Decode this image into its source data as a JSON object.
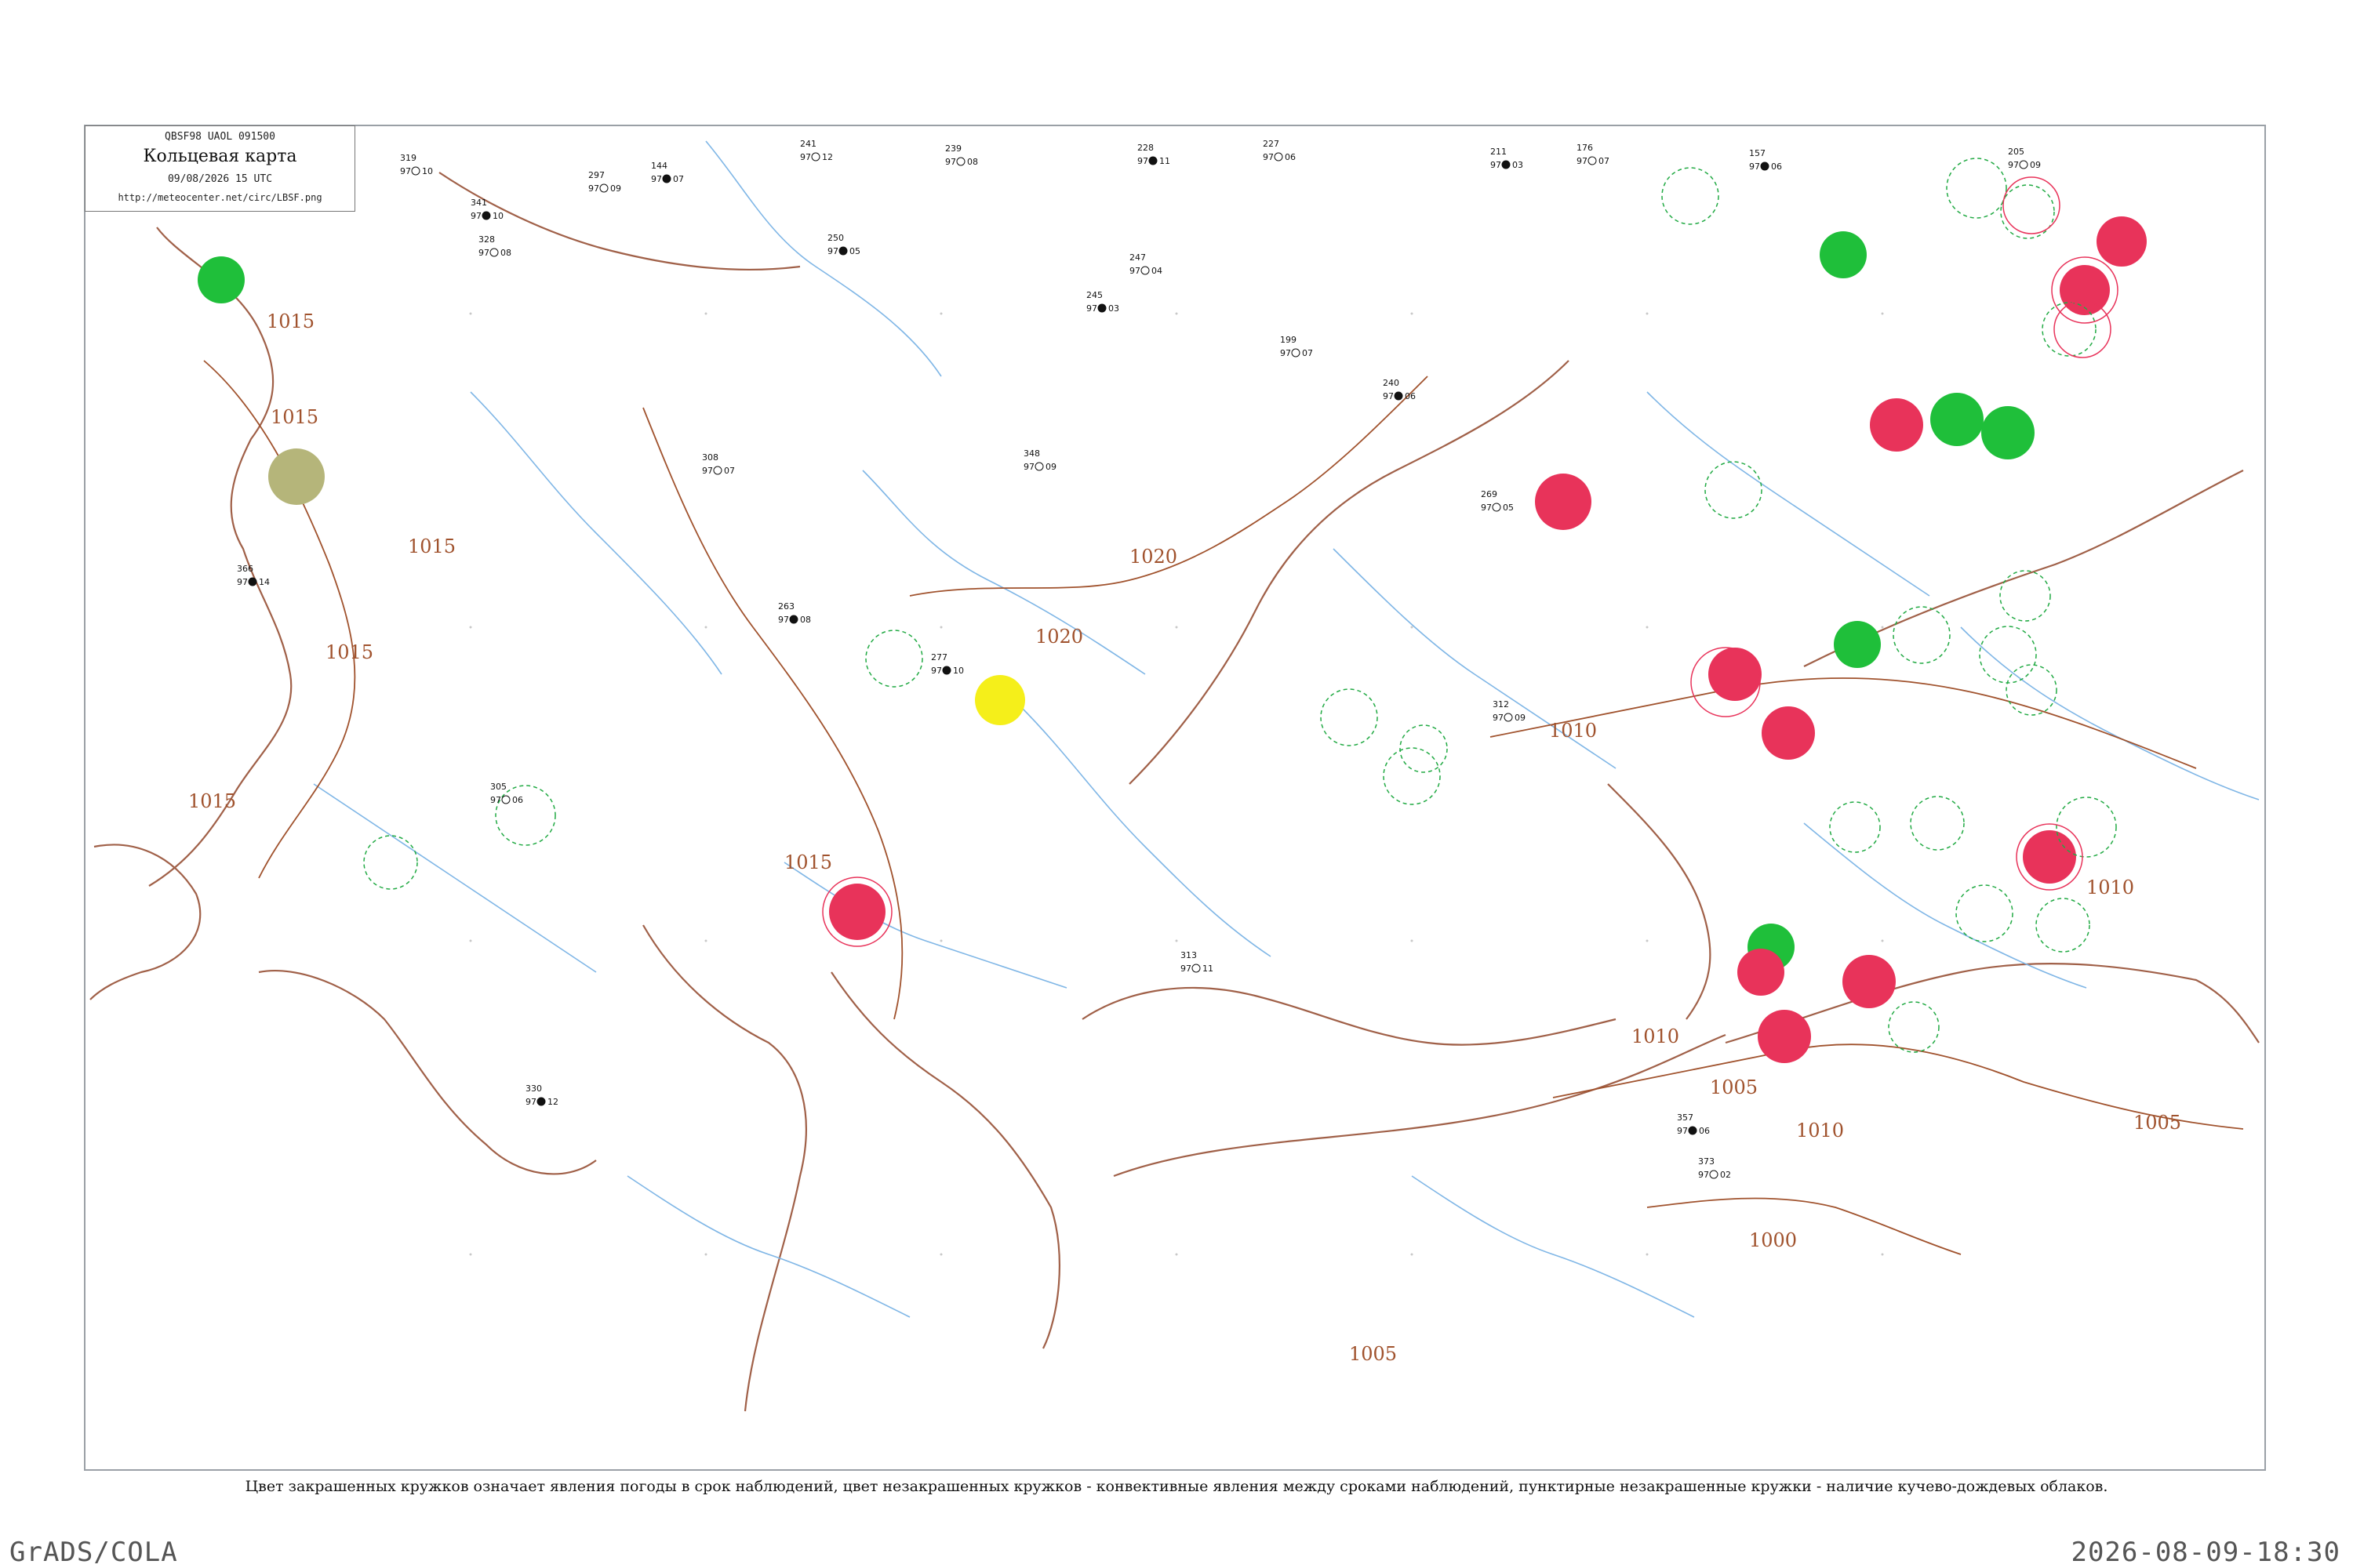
{
  "header": {
    "code": "QBSF98  UAOL  091500",
    "title": "Кольцевая карта",
    "date": "09/08/2026 15 UTC",
    "url": "http://meteocenter.net/circ/LBSF.png"
  },
  "caption": "Цвет закрашенных кружков означает явления погоды в срок наблюдений, цвет незакрашенных кружков - конвективные явления между сроками наблюдений, пунктирные незакрашенные кружки - наличие кучево-дождевых облаков.",
  "footer": {
    "left": "GrADS/COLA",
    "right": "2026-08-09-18:30"
  },
  "isobars": [
    "1015",
    "1015",
    "1015",
    "1015",
    "1015",
    "1020",
    "1020",
    "1015",
    "1010",
    "1010",
    "1010",
    "1010",
    "1005",
    "1005",
    "1005",
    "1000"
  ],
  "colors": {
    "coast": "#a06048",
    "river": "#7fb6e6",
    "isobar": "#a0522d",
    "thunder": "#e8335a",
    "rain": "#1fbf3a",
    "fog": "#f5ef1a",
    "haze": "#b5b57a",
    "cb": "#22aa44"
  },
  "stations": [
    {
      "p": "319",
      "t": "97",
      "id": "10"
    },
    {
      "p": "297",
      "t": "97",
      "id": "09"
    },
    {
      "p": "144",
      "t": "97",
      "id": "07"
    },
    {
      "p": "241",
      "t": "97",
      "id": "12"
    },
    {
      "p": "239",
      "t": "97",
      "id": "08"
    },
    {
      "p": "228",
      "t": "97",
      "id": "11"
    },
    {
      "p": "227",
      "t": "97",
      "id": "06"
    },
    {
      "p": "211",
      "t": "97",
      "id": "03"
    },
    {
      "p": "176",
      "t": "97",
      "id": "07"
    },
    {
      "p": "157",
      "t": "97",
      "id": "06"
    },
    {
      "p": "205",
      "t": "97",
      "id": "09"
    },
    {
      "p": "341",
      "t": "97",
      "id": "10"
    },
    {
      "p": "328",
      "t": "97",
      "id": "08"
    },
    {
      "p": "308",
      "t": "97",
      "id": "07"
    },
    {
      "p": "250",
      "t": "97",
      "id": "05"
    },
    {
      "p": "247",
      "t": "97",
      "id": "04"
    },
    {
      "p": "245",
      "t": "97",
      "id": "03"
    },
    {
      "p": "199",
      "t": "97",
      "id": "07"
    },
    {
      "p": "240",
      "t": "97",
      "id": "06"
    },
    {
      "p": "269",
      "t": "97",
      "id": "05"
    },
    {
      "p": "305",
      "t": "97",
      "id": "06"
    },
    {
      "p": "366",
      "t": "97",
      "id": "14"
    },
    {
      "p": "348",
      "t": "97",
      "id": "09"
    },
    {
      "p": "277",
      "t": "97",
      "id": "10"
    },
    {
      "p": "312",
      "t": "97",
      "id": "09"
    },
    {
      "p": "263",
      "t": "97",
      "id": "08"
    },
    {
      "p": "373",
      "t": "97",
      "id": "02"
    },
    {
      "p": "330",
      "t": "97",
      "id": "12"
    },
    {
      "p": "313",
      "t": "97",
      "id": "11"
    },
    {
      "p": "357",
      "t": "97",
      "id": "06"
    }
  ],
  "weather_circles": [
    {
      "kind": "rain"
    },
    {
      "kind": "rain"
    },
    {
      "kind": "rain"
    },
    {
      "kind": "rain"
    },
    {
      "kind": "rain"
    },
    {
      "kind": "rain"
    },
    {
      "kind": "thunder"
    },
    {
      "kind": "thunder"
    },
    {
      "kind": "thunder"
    },
    {
      "kind": "thunder"
    },
    {
      "kind": "thunder"
    },
    {
      "kind": "thunder"
    },
    {
      "kind": "thunder"
    },
    {
      "kind": "thunder"
    },
    {
      "kind": "thunder"
    },
    {
      "kind": "thunder"
    },
    {
      "kind": "thunder"
    },
    {
      "kind": "fog"
    },
    {
      "kind": "haze"
    }
  ]
}
